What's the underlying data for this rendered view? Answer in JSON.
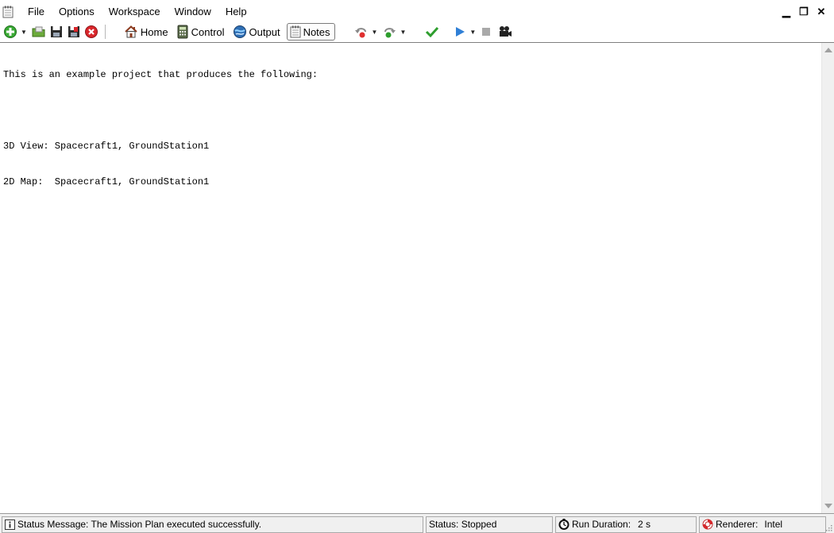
{
  "menu": {
    "items": [
      "File",
      "Options",
      "Workspace",
      "Window",
      "Help"
    ]
  },
  "window_controls": {
    "minimize": "▁",
    "restore": "❐",
    "close": "✕"
  },
  "toolbar": {
    "home_label": "Home",
    "control_label": "Control",
    "output_label": "Output",
    "notes_label": "Notes",
    "dropdown_glyph": "▼"
  },
  "notes": {
    "lines": [
      "This is an example project that produces the following:",
      "",
      "3D View: Spacecraft1, GroundStation1",
      "2D Map:  Spacecraft1, GroundStation1"
    ]
  },
  "status_bar": {
    "message": "Status Message: The Mission Plan executed successfully.",
    "status": "Status: Stopped",
    "run_duration_label": "Run Duration:",
    "run_duration_value": "2 s",
    "renderer_label": "Renderer:",
    "renderer_value": "Intel"
  },
  "colors": {
    "accent_green": "#2e9e2e",
    "close_red": "#d9262b",
    "play_blue": "#2f7fd6"
  }
}
